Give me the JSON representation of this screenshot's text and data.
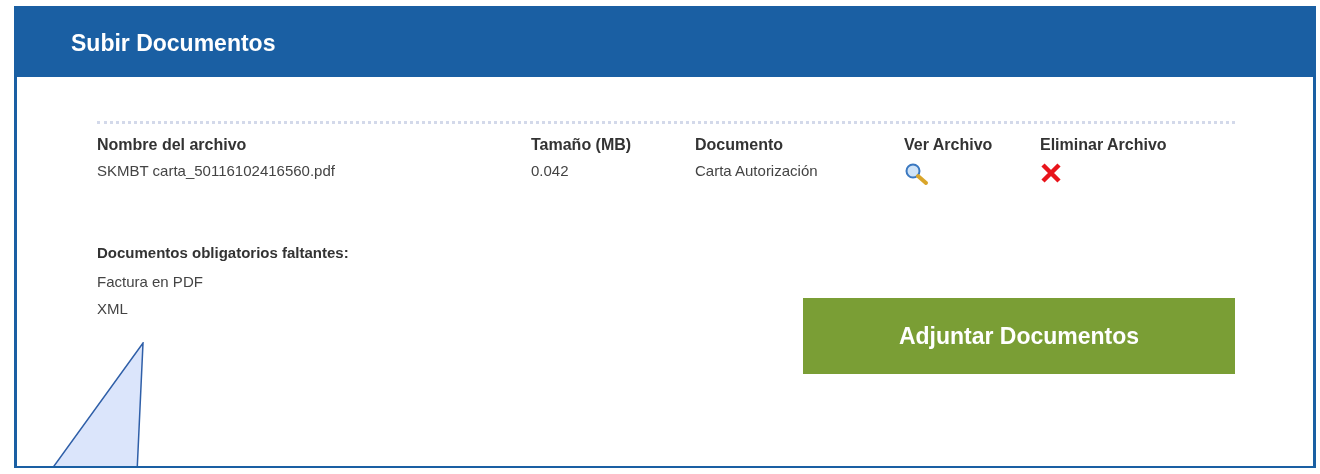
{
  "panel": {
    "title": "Subir Documentos"
  },
  "files": {
    "columns": [
      "Nombre del archivo",
      "Tamaño (MB)",
      "Documento",
      "Ver Archivo",
      "Eliminar Archivo"
    ],
    "rows": [
      {
        "name": "SKMBT carta_50116102416560.pdf",
        "size": "0.042",
        "document": "Carta Autorización"
      }
    ]
  },
  "missing": {
    "label": "Documentos obligatorios faltantes:",
    "items": [
      "Factura en PDF",
      "XML"
    ]
  },
  "button": {
    "label": "Adjuntar Documentos"
  }
}
